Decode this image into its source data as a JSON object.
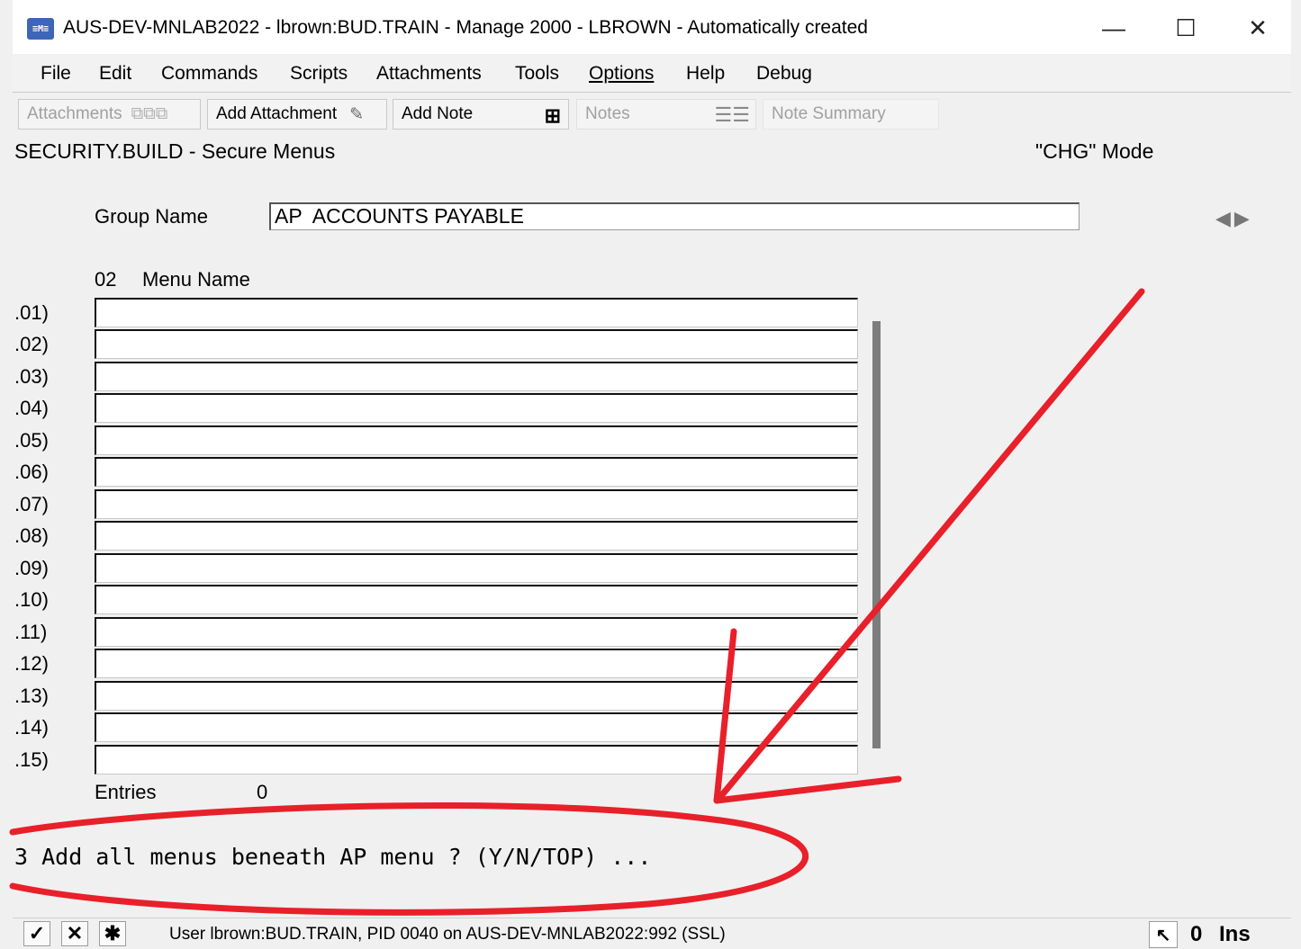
{
  "window": {
    "title": "AUS-DEV-MNLAB2022 - lbrown:BUD.TRAIN - Manage 2000 - LBROWN - Automatically created",
    "app_icon_text": "≡M≡",
    "minimize_glyph": "—",
    "maximize_glyph": "☐",
    "close_glyph": "✕"
  },
  "menu": [
    {
      "label": "File"
    },
    {
      "label": "Edit"
    },
    {
      "label": "Commands"
    },
    {
      "label": "Scripts"
    },
    {
      "label": "Attachments"
    },
    {
      "label": "Tools"
    },
    {
      "label": "Options"
    },
    {
      "label": "Help"
    },
    {
      "label": "Debug"
    }
  ],
  "toolbar": {
    "attachments_label": "Attachments",
    "add_attachment_label": "Add Attachment",
    "add_note_label": "Add Note",
    "notes_label": "Notes",
    "note_summary_label": "Note Summary"
  },
  "screen": {
    "title": "SECURITY.BUILD - Secure Menus",
    "mode": "\"CHG\" Mode",
    "group_name_label": "Group Name",
    "group_name_value": "AP  ACCOUNTS PAYABLE",
    "field_number": "02",
    "menu_name_header": "Menu Name",
    "rows": [
      {
        "num": ".01)",
        "value": ""
      },
      {
        "num": ".02)",
        "value": ""
      },
      {
        "num": ".03)",
        "value": ""
      },
      {
        "num": ".04)",
        "value": ""
      },
      {
        "num": ".05)",
        "value": ""
      },
      {
        "num": ".06)",
        "value": ""
      },
      {
        "num": ".07)",
        "value": ""
      },
      {
        "num": ".08)",
        "value": ""
      },
      {
        "num": ".09)",
        "value": ""
      },
      {
        "num": ".10)",
        "value": ""
      },
      {
        "num": ".11)",
        "value": ""
      },
      {
        "num": ".12)",
        "value": ""
      },
      {
        "num": ".13)",
        "value": ""
      },
      {
        "num": ".14)",
        "value": ""
      },
      {
        "num": ".15)",
        "value": ""
      }
    ],
    "entries_label": "Entries",
    "entries_count": "0",
    "prompt": "3 Add all menus beneath AP menu ? (Y/N/TOP) ..."
  },
  "status": {
    "user_text": "User lbrown:BUD.TRAIN, PID 0040 on AUS-DEV-MNLAB2022:992 (SSL)",
    "count": "0",
    "ins": "Ins"
  },
  "colors": {
    "annotation": "#e8202a",
    "app_icon": "#3d66b8"
  }
}
